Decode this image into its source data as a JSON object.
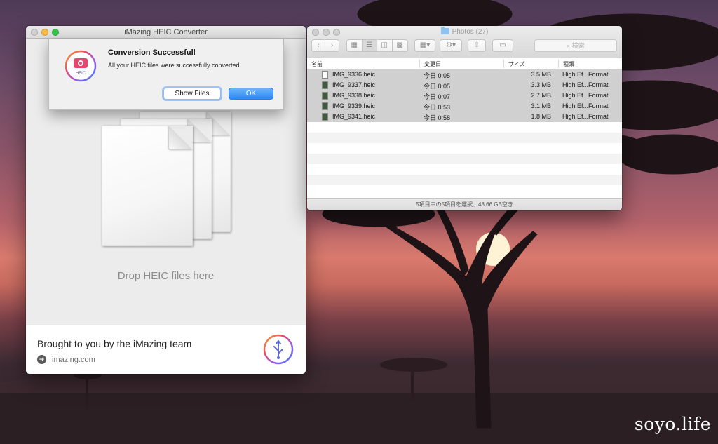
{
  "colors": {
    "close": "#fc605b",
    "minimize": "#fdbc40",
    "zoom": "#34c84a",
    "inactive_light": "#d1d1d1",
    "accent_blue": "#2c8af5"
  },
  "imazing": {
    "title": "iMazing HEIC Converter",
    "drop_label": "Drop HEIC files here",
    "footer_text": "Brought to you by the iMazing team",
    "footer_link": "imazing.com"
  },
  "dialog": {
    "icon_label": "HEIC",
    "title": "Conversion Successfull",
    "message": "All your HEIC files were successfully converted.",
    "show_files_label": "Show Files",
    "ok_label": "OK"
  },
  "finder": {
    "title": "Photos (27)",
    "search_placeholder": "検索",
    "columns": {
      "name": "名前",
      "modified": "変更日",
      "size": "サイズ",
      "kind": "種類"
    },
    "files": [
      {
        "name": "IMG_9336.heic",
        "modified": "今日 0:05",
        "size": "3.5 MB",
        "kind": "High Ef...Format",
        "icon": "light"
      },
      {
        "name": "IMG_9337.heic",
        "modified": "今日 0:05",
        "size": "3.3 MB",
        "kind": "High Ef...Format",
        "icon": "dark"
      },
      {
        "name": "IMG_9338.heic",
        "modified": "今日 0:07",
        "size": "2.7 MB",
        "kind": "High Ef...Format",
        "icon": "dark"
      },
      {
        "name": "IMG_9339.heic",
        "modified": "今日 0:53",
        "size": "3.1 MB",
        "kind": "High Ef...Format",
        "icon": "dark"
      },
      {
        "name": "IMG_9341.heic",
        "modified": "今日 0:58",
        "size": "1.8 MB",
        "kind": "High Ef...Format",
        "icon": "dark"
      }
    ],
    "status": "5項目中の5項目を選択、48.66 GB空き"
  },
  "watermark": "soyo.life"
}
